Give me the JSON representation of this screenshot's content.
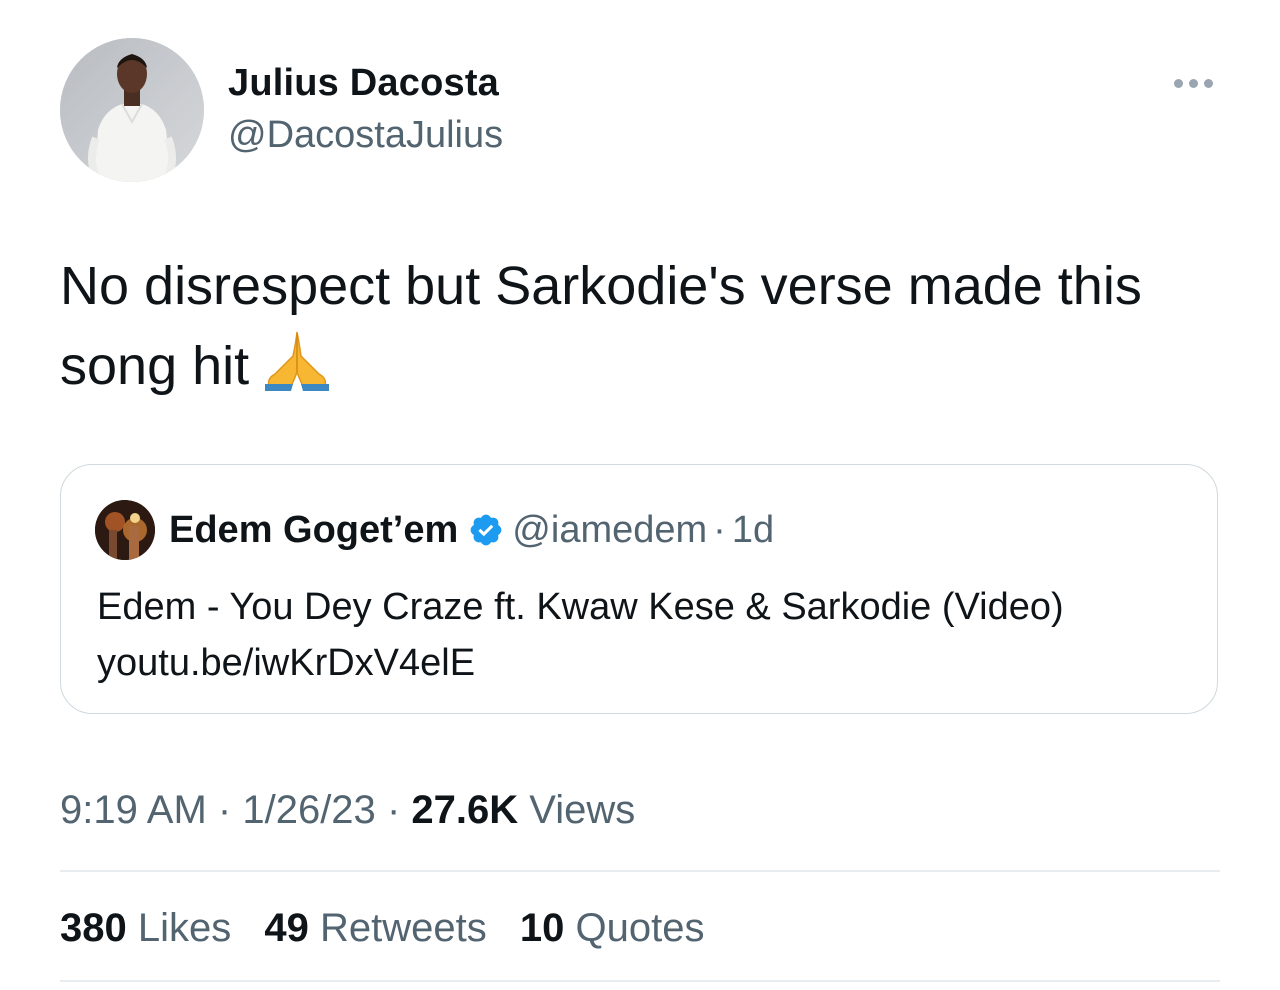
{
  "tweet": {
    "author": {
      "name": "Julius Dacosta",
      "handle": "@DacostaJulius"
    },
    "text": "No disrespect but Sarkodie's verse made this song hit",
    "emoji": "folded-hands-icon",
    "quoted": {
      "name": "Edem Goget’em",
      "verified": true,
      "handle": "@iamedem",
      "separator": "·",
      "age": "1d",
      "text_line1": "Edem - You Dey Craze ft. Kwaw Kese & Sarkodie (Video)",
      "text_line2": "youtu.be/iwKrDxV4elE"
    },
    "meta": {
      "time": "9:19 AM",
      "sep1": "·",
      "date": "1/26/23",
      "sep2": "·",
      "views_count": "27.6K",
      "views_label": "Views"
    },
    "stats": {
      "likes_count": "380",
      "likes_label": "Likes",
      "retweets_count": "49",
      "retweets_label": "Retweets",
      "quotes_count": "10",
      "quotes_label": "Quotes"
    }
  },
  "colors": {
    "text_primary": "#0f1419",
    "text_secondary": "#536471",
    "border": "#cfd9de",
    "verified_blue": "#1d9bf0",
    "more_dots": "#9aa5b1"
  }
}
